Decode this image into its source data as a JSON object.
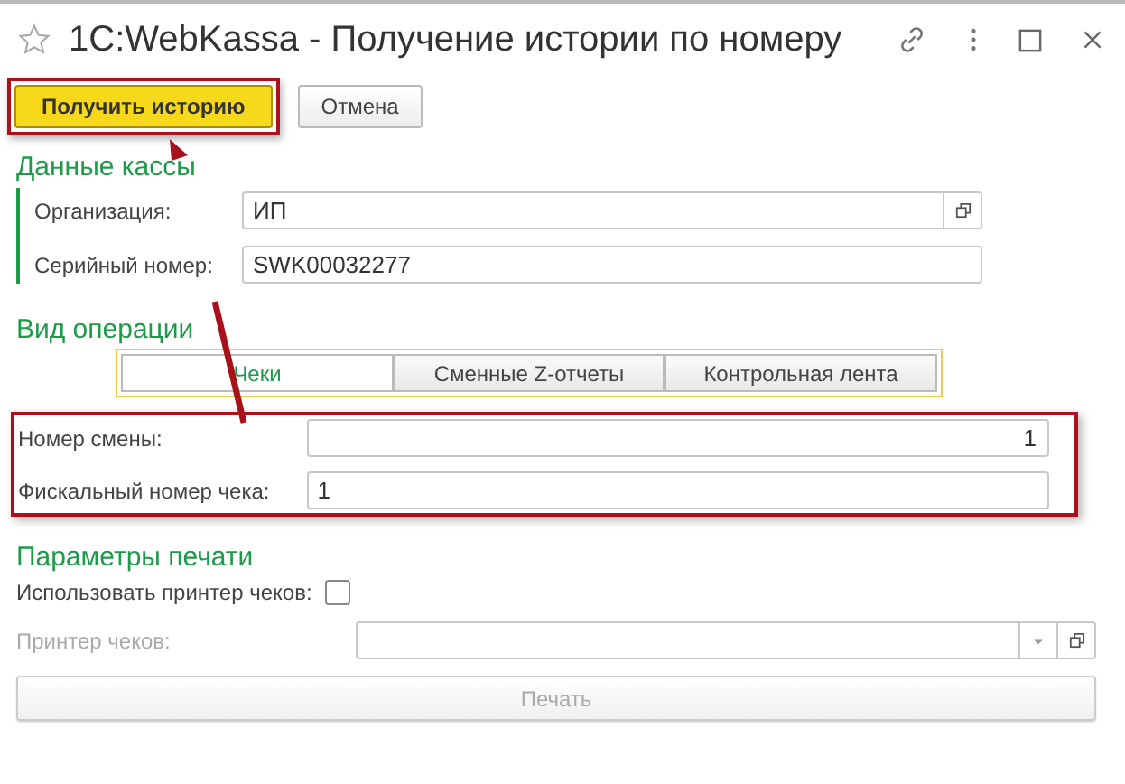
{
  "window": {
    "title": "1C:WebKassa - Получение истории по номеру",
    "favorite": false
  },
  "toolbar": [
    {
      "label": "Получить историю",
      "kind": "primary",
      "highlighted": true
    },
    {
      "label": "Отмена",
      "kind": "default",
      "highlighted": false
    }
  ],
  "register_section": {
    "title": "Данные кассы",
    "fields": [
      {
        "label": "Организация:",
        "value": "ИП",
        "kind": "select"
      },
      {
        "label": "Серийный номер:",
        "value": "SWK00032277",
        "kind": "text"
      }
    ]
  },
  "operation_section": {
    "title": "Вид операции",
    "tabs": [
      {
        "label": "Чеки",
        "selected": true
      },
      {
        "label": "Сменные Z-отчеты",
        "selected": false
      },
      {
        "label": "Контрольная лента",
        "selected": false
      }
    ],
    "fields": [
      {
        "label": "Номер смены:",
        "value": "1",
        "kind": "number"
      },
      {
        "label": "Фискальный номер чека:",
        "value": "1",
        "kind": "text"
      }
    ],
    "highlighted": true
  },
  "print_section": {
    "title": "Параметры печати",
    "use_printer": {
      "label": "Использовать принтер чеков:",
      "checked": false
    },
    "printer": {
      "label": "Принтер чеков:",
      "disabled": true
    },
    "print_button": {
      "label": "Печать",
      "disabled": true
    }
  }
}
